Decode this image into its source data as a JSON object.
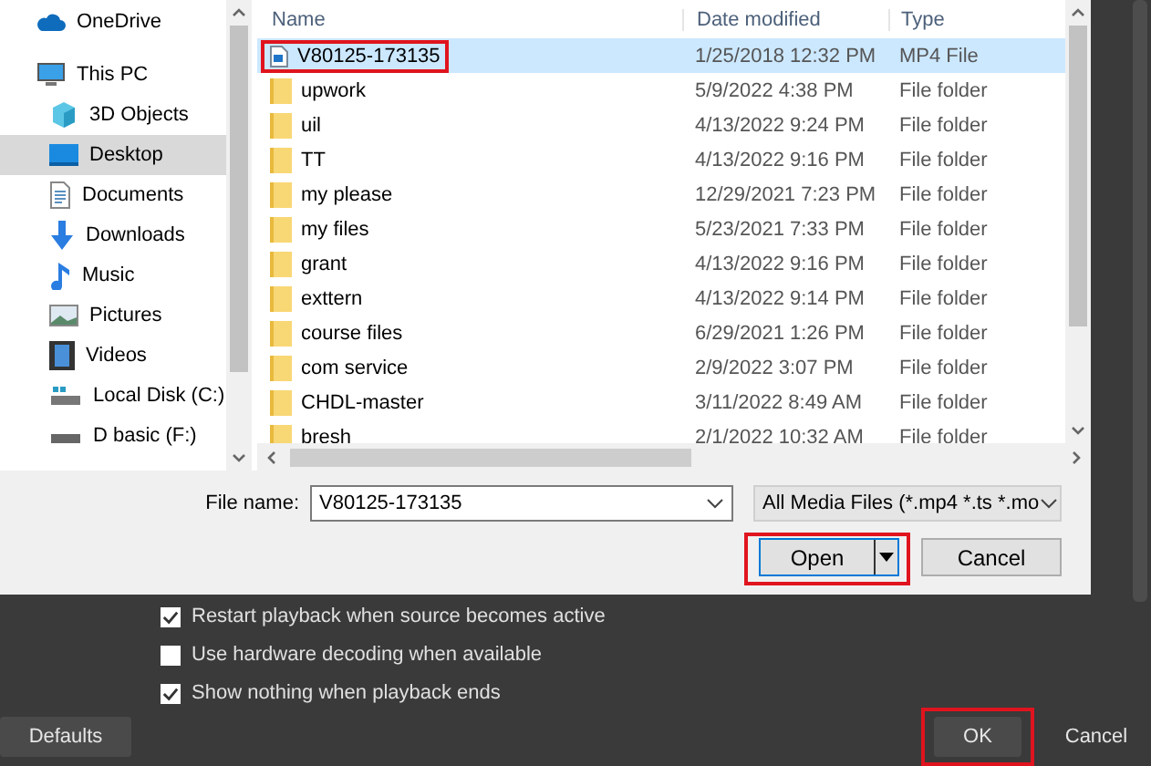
{
  "nav": {
    "items": [
      {
        "label": "OneDrive",
        "selected": false
      },
      {
        "label": "This PC",
        "selected": false,
        "children": [
          {
            "label": "3D Objects",
            "selected": false
          },
          {
            "label": "Desktop",
            "selected": true
          },
          {
            "label": "Documents",
            "selected": false
          },
          {
            "label": "Downloads",
            "selected": false
          },
          {
            "label": "Music",
            "selected": false
          },
          {
            "label": "Pictures",
            "selected": false
          },
          {
            "label": "Videos",
            "selected": false
          },
          {
            "label": "Local Disk (C:)",
            "selected": false
          },
          {
            "label": "D basic (F:)",
            "selected": false
          }
        ]
      }
    ]
  },
  "table": {
    "columns": [
      "Name",
      "Date modified",
      "Type"
    ],
    "rows": [
      {
        "kind": "file",
        "name": "V80125-173135",
        "date": "1/25/2018 12:32 PM",
        "type": "MP4 File",
        "selected": true,
        "highlighted": true
      },
      {
        "kind": "folder",
        "name": "upwork",
        "date": "5/9/2022 4:38 PM",
        "type": "File folder",
        "selected": false,
        "highlighted": false
      },
      {
        "kind": "folder",
        "name": "uil",
        "date": "4/13/2022 9:24 PM",
        "type": "File folder",
        "selected": false,
        "highlighted": false
      },
      {
        "kind": "folder",
        "name": "TT",
        "date": "4/13/2022 9:16 PM",
        "type": "File folder",
        "selected": false,
        "highlighted": false
      },
      {
        "kind": "folder",
        "name": "my please",
        "date": "12/29/2021 7:23 PM",
        "type": "File folder",
        "selected": false,
        "highlighted": false
      },
      {
        "kind": "folder",
        "name": "my files",
        "date": "5/23/2021 7:33 PM",
        "type": "File folder",
        "selected": false,
        "highlighted": false
      },
      {
        "kind": "folder",
        "name": "grant",
        "date": "4/13/2022 9:16 PM",
        "type": "File folder",
        "selected": false,
        "highlighted": false
      },
      {
        "kind": "folder",
        "name": "exttern",
        "date": "4/13/2022 9:14 PM",
        "type": "File folder",
        "selected": false,
        "highlighted": false
      },
      {
        "kind": "folder",
        "name": "course files",
        "date": "6/29/2021 1:26 PM",
        "type": "File folder",
        "selected": false,
        "highlighted": false
      },
      {
        "kind": "folder",
        "name": "com service",
        "date": "2/9/2022 3:07 PM",
        "type": "File folder",
        "selected": false,
        "highlighted": false
      },
      {
        "kind": "folder",
        "name": "CHDL-master",
        "date": "3/11/2022 8:49 AM",
        "type": "File folder",
        "selected": false,
        "highlighted": false
      },
      {
        "kind": "folder",
        "name": "bresh",
        "date": "2/1/2022 10:32 AM",
        "type": "File folder",
        "selected": false,
        "highlighted": false
      }
    ]
  },
  "file_name": {
    "label": "File name:",
    "value": "V80125-173135"
  },
  "filter": {
    "value": "All Media Files (*.mp4 *.ts *.mo"
  },
  "dialog_buttons": [
    {
      "label": "Open",
      "kind": "split",
      "highlighted": true
    },
    {
      "label": "Cancel",
      "kind": "plain",
      "highlighted": false
    }
  ],
  "options": [
    {
      "label": "Restart playback when source becomes active",
      "checked": true
    },
    {
      "label": "Use hardware decoding when available",
      "checked": false
    },
    {
      "label": "Show nothing when playback ends",
      "checked": true
    }
  ],
  "defaults_button": {
    "label": "Defaults"
  },
  "buttons": [
    {
      "label": "OK",
      "highlighted": true
    },
    {
      "label": "Cancel",
      "highlighted": false
    }
  ]
}
